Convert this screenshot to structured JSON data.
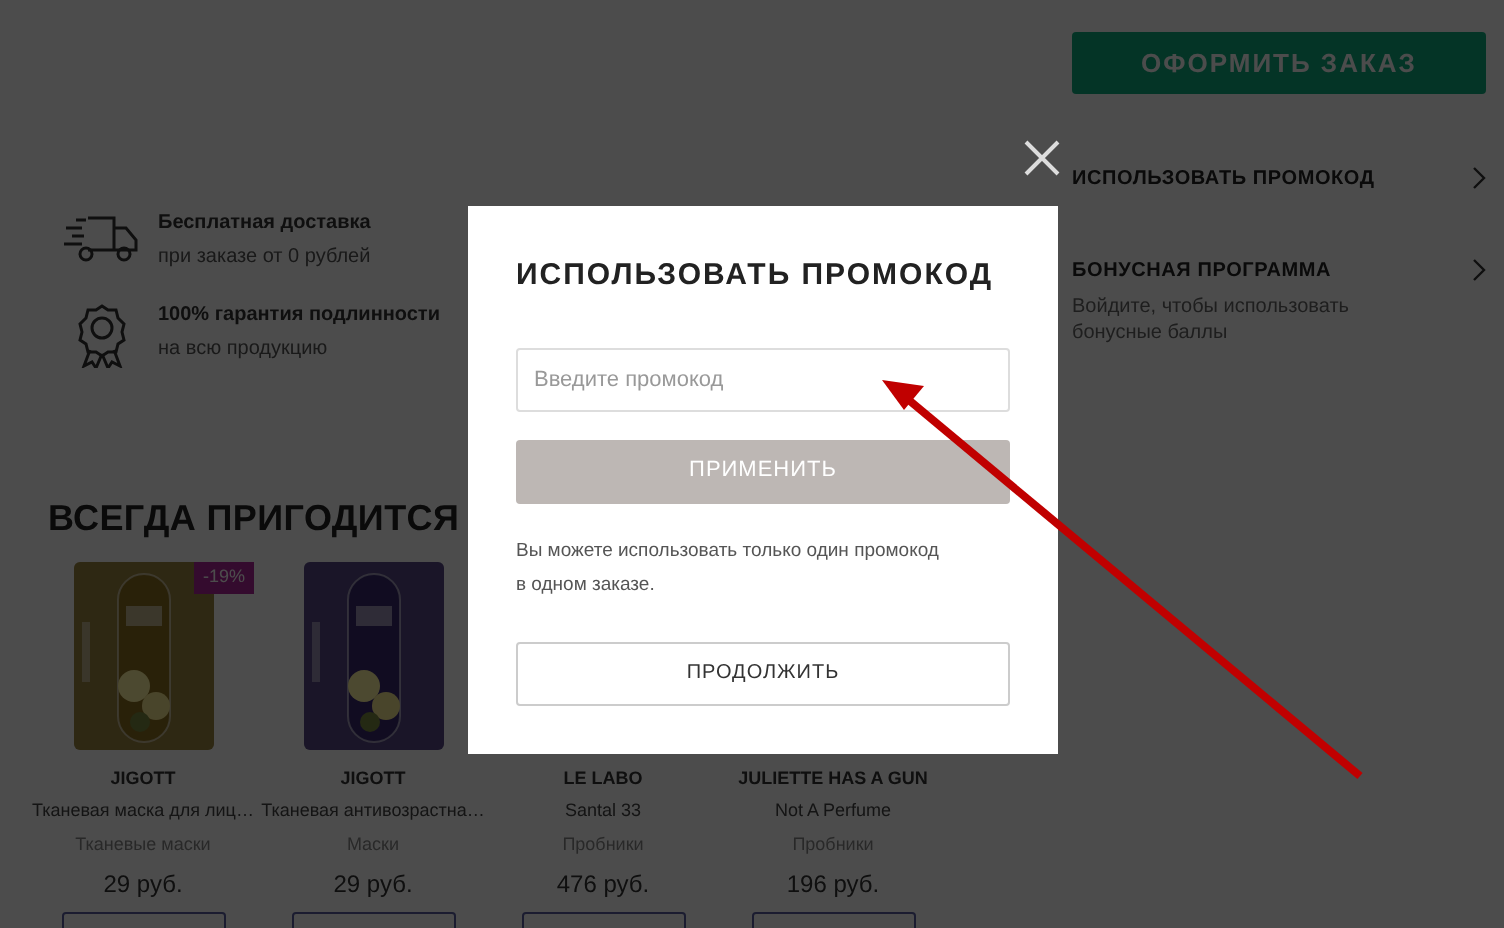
{
  "checkout": {
    "order_button": "ОФОРМИТЬ ЗАКАЗ",
    "links": [
      {
        "title": "ИСПОЛЬЗОВАТЬ ПРОМОКОД"
      },
      {
        "title": "БОНУСНАЯ ПРОГРАММА",
        "note": "Войдите, чтобы использовать бонусные баллы"
      }
    ]
  },
  "features": [
    {
      "kind": "delivery",
      "title": "Бесплатная доставка",
      "subtitle": "при заказе от 0 рублей"
    },
    {
      "kind": "guarantee",
      "title": "100% гарантия подлинности",
      "subtitle": "на всю продукцию"
    }
  ],
  "section_title": "ВСЕГДА ПРИГОДИТСЯ",
  "products": [
    {
      "badge": "-19%",
      "brand": "JIGOTT",
      "name": "Тканевая маска для лиц…",
      "category": "Тканевые маски",
      "price": "29 руб."
    },
    {
      "brand": "JIGOTT",
      "name": "Тканевая антивозрастна…",
      "category": "Маски",
      "price": "29 руб."
    },
    {
      "brand": "LE LABO",
      "name": "Santal 33",
      "category": "Пробники",
      "price": "476 руб."
    },
    {
      "brand": "JULIETTE HAS A GUN",
      "name": "Not A Perfume",
      "category": "Пробники",
      "price": "196 руб."
    }
  ],
  "modal": {
    "title": "ИСПОЛЬЗОВАТЬ ПРОМОКОД",
    "placeholder": "Введите промокод",
    "apply_button": "ПРИМЕНИТЬ",
    "apply_disabled": true,
    "info": "Вы можете использовать только один промокод в одном заказе.",
    "continue_button": "ПРОДОЛЖИТЬ"
  }
}
